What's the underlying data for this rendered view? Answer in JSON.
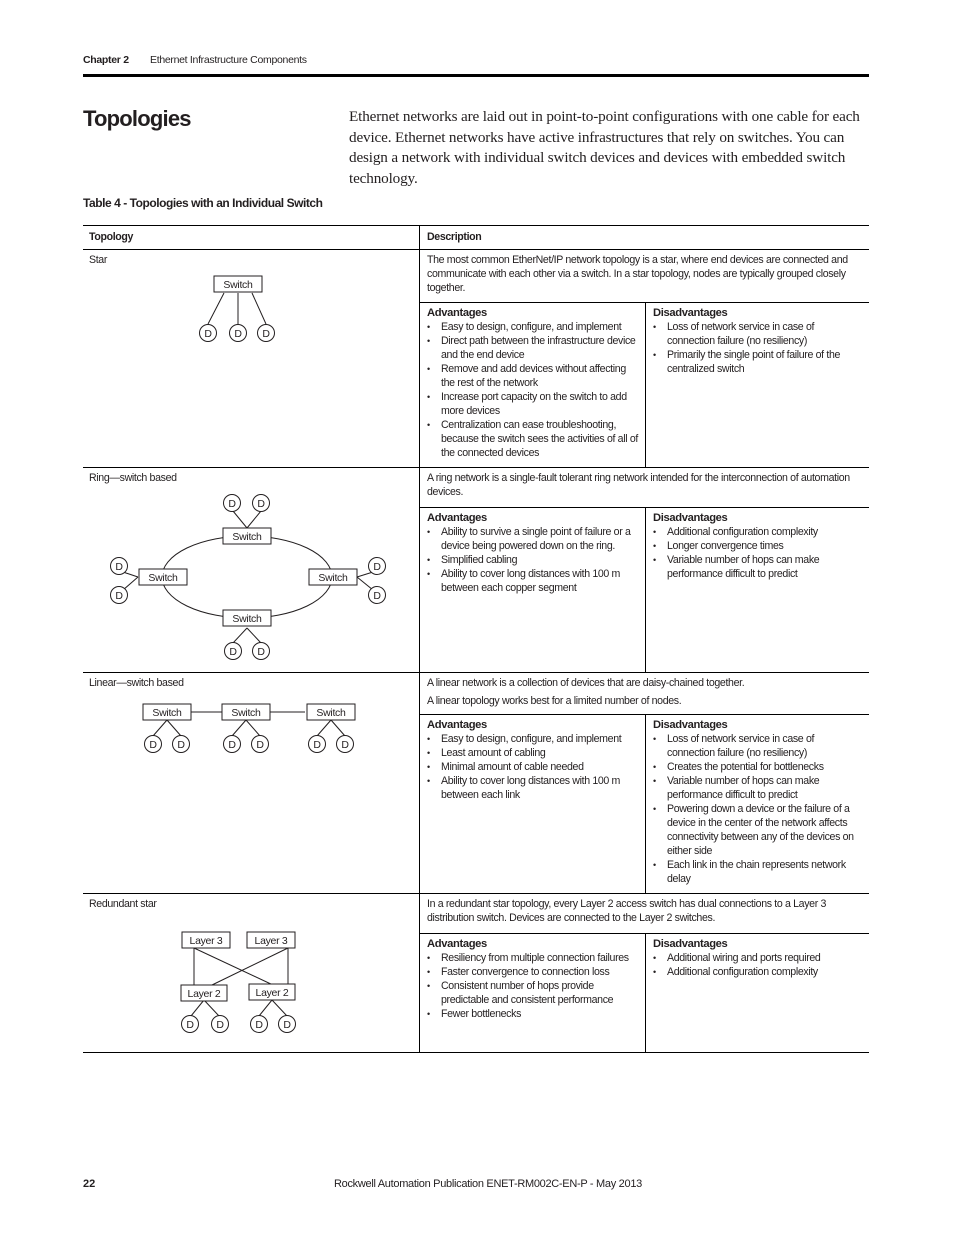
{
  "header": {
    "chapter": "Chapter 2",
    "section": "Ethernet Infrastructure Components"
  },
  "title": "Topologies",
  "intro": "Ethernet networks are laid out in point-to-point configurations with one cable for each device. Ethernet networks have active infrastructures that rely on switches. You can design a network with individual switch devices and devices with embedded switch technology.",
  "table": {
    "caption": "Table 4 - Topologies with an Individual Switch",
    "headers": {
      "topology": "Topology",
      "description": "Description"
    },
    "advantages_label": "Advantages",
    "disadvantages_label": "Disadvantages",
    "rows": [
      {
        "topology": "Star",
        "description": [
          "The most common EtherNet/IP network topology is a star, where end devices are connected and communicate with each other via a switch. In a star topology, nodes are typically grouped closely together."
        ],
        "advantages": [
          "Easy to design, configure, and implement",
          "Direct path between the infrastructure device and the end device",
          "Remove and add devices without affecting the rest of the network",
          "Increase port capacity on the switch to add more devices",
          "Centralization can ease troubleshooting, because the switch sees the activities of all of the connected devices"
        ],
        "disadvantages": [
          "Loss of network service in case of connection failure (no resiliency)",
          "Primarily the single point of failure of the centralized switch"
        ]
      },
      {
        "topology": "Ring—switch based",
        "description": [
          "A ring network is a single-fault tolerant ring network intended for the interconnection of automation devices."
        ],
        "advantages": [
          "Ability to survive a single point of failure or a device being powered down on the ring.",
          "Simplified cabling",
          "Ability to cover long distances with 100 m between each copper segment"
        ],
        "disadvantages": [
          "Additional configuration complexity",
          "Longer convergence times",
          "Variable number of hops can make performance difficult to predict"
        ]
      },
      {
        "topology": "Linear—switch based",
        "description": [
          "A linear network is a collection of devices that are daisy-chained together.",
          "A linear topology works best for a limited number of nodes."
        ],
        "advantages": [
          "Easy to design, configure, and implement",
          "Least amount of cabling",
          "Minimal amount of cable needed",
          "Ability to cover long distances with 100 m between each link"
        ],
        "disadvantages": [
          "Loss of network service in case of connection failure (no resiliency)",
          "Creates the potential for bottlenecks",
          "Variable number of hops can make performance difficult to predict",
          "Powering down a device or the failure of a device in the center of the network affects connectivity between any of the devices on either side",
          "Each link in the chain represents network delay"
        ]
      },
      {
        "topology": "Redundant star",
        "description": [
          "In a redundant star topology, every Layer 2 access switch has dual connections to a Layer 3 distribution switch. Devices are connected to the Layer 2 switches."
        ],
        "advantages": [
          "Resiliency from multiple connection failures",
          "Faster convergence to connection loss",
          "Consistent number of hops provide predictable and consistent performance",
          "Fewer bottlenecks"
        ],
        "disadvantages": [
          "Additional wiring and ports required",
          "Additional configuration complexity"
        ]
      }
    ]
  },
  "diagram_labels": {
    "switch": "Switch",
    "device": "D",
    "layer3": "Layer 3",
    "layer2": "Layer 2"
  },
  "footer": {
    "page_number": "22",
    "publication": "Rockwell Automation Publication ENET-RM002C-EN-P - May 2013"
  }
}
